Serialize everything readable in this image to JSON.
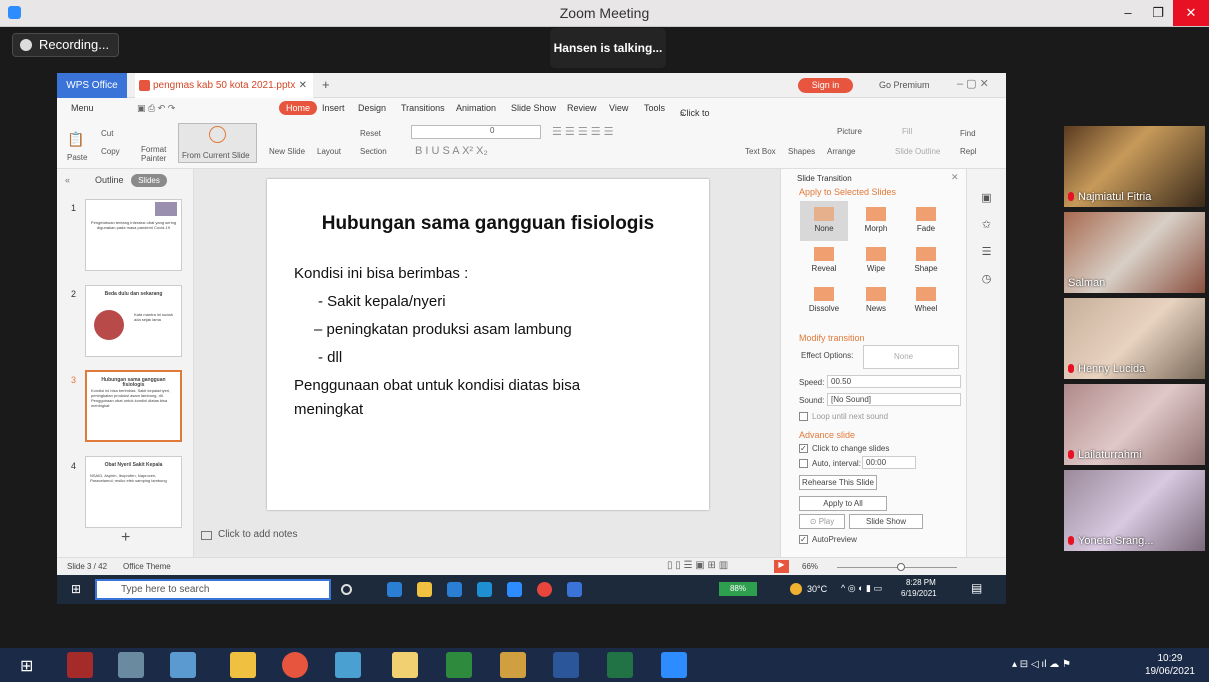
{
  "zoom": {
    "title": "Zoom Meeting",
    "recording": "Recording...",
    "talking": "Hansen is talking..."
  },
  "wps": {
    "app_tab": "WPS Office",
    "file_tab": "pengmas kab 50 kota 2021.pptx",
    "sign_in": "Sign in",
    "go_premium": "Go Premium",
    "menu": [
      "Menu",
      "Home",
      "Insert",
      "Design",
      "Transitions",
      "Animation",
      "Slide Show",
      "Review",
      "View",
      "Tools"
    ],
    "search": "Click to find commands",
    "ribbon": {
      "paste": "Paste",
      "cut": "Cut",
      "copy": "Copy",
      "format_painter": "Format Painter",
      "from_current": "From Current Slide",
      "new_slide": "New Slide",
      "layout": "Layout",
      "reset": "Reset",
      "section": "Section",
      "font_size": "0",
      "textbox": "Text Box",
      "shapes": "Shapes",
      "picture": "Picture",
      "arrange": "Arrange",
      "fill": "Fill",
      "slide_outline": "Slide Outline",
      "find": "Find",
      "replace": "Repl"
    },
    "outline_tab": "Outline",
    "slides_tab": "Slides",
    "thumbs": [
      {
        "num": "1",
        "text": "Pengetahuan tentang Interaksi obat yang sering digunakan pada masa pandemi Covid-19"
      },
      {
        "num": "2",
        "title": "Beda dulu dan sekarang",
        "text": "Kata mantra ini sudah ada sejak lama"
      },
      {
        "num": "3",
        "title": "Hubungan sama gangguan fisiologis",
        "text": "Kondisi ini bisa berimbas: Sakit kepala/nyeri, peningkatan produksi asam lambung, dll. Penggunaan obat untuk kondisi diatas bisa meningkat"
      },
      {
        "num": "4",
        "title": "Obat Nyeri/ Sakit Kepala",
        "text": "NSAID, Aspirin, Ibuprofen, Naproxen, Paracetamol; resiko efek samping lambung"
      }
    ],
    "slide": {
      "title": "Hubungan sama gangguan fisiologis",
      "lines": [
        "Kondisi ini bisa berimbas :",
        "- Sakit kepala/nyeri",
        "–  peningkatan produksi asam lambung",
        "- dll",
        "Penggunaan obat untuk kondisi diatas bisa",
        "meningkat"
      ]
    },
    "notes": "Click to add notes",
    "panel": {
      "header": "Slide Transition",
      "apply": "Apply to Selected Slides",
      "transitions": [
        "None",
        "Morph",
        "Fade",
        "Reveal",
        "Wipe",
        "Shape",
        "Dissolve",
        "News",
        "Wheel"
      ],
      "modify": "Modify transition",
      "effect_options": "Effect Options:",
      "effect_value": "None",
      "speed_label": "Speed:",
      "speed": "00.50",
      "sound_label": "Sound:",
      "sound": "[No Sound]",
      "loop": "Loop until next sound",
      "advance": "Advance slide",
      "on_click": "Click to change slides",
      "auto": "Auto, interval:",
      "interval": "00:00",
      "rehearse": "Rehearse This Slide",
      "apply_all": "Apply to All",
      "play": "Play",
      "slideshow": "Slide Show",
      "autopreview": "AutoPreview"
    },
    "status": {
      "slide": "Slide 3 / 42",
      "theme": "Office Theme",
      "zoom": "66%"
    },
    "taskbar": {
      "search": "Type here to search",
      "battery": "88%",
      "weather": "30°C",
      "time": "8:28 PM",
      "date": "6/19/2021"
    }
  },
  "participants": [
    "Najmiatul Fitria",
    "Salman",
    "Henny Lucida",
    "Lailaturrahmi",
    "Yoneta Srang..."
  ],
  "win": {
    "time": "10:29",
    "date": "19/06/2021"
  }
}
